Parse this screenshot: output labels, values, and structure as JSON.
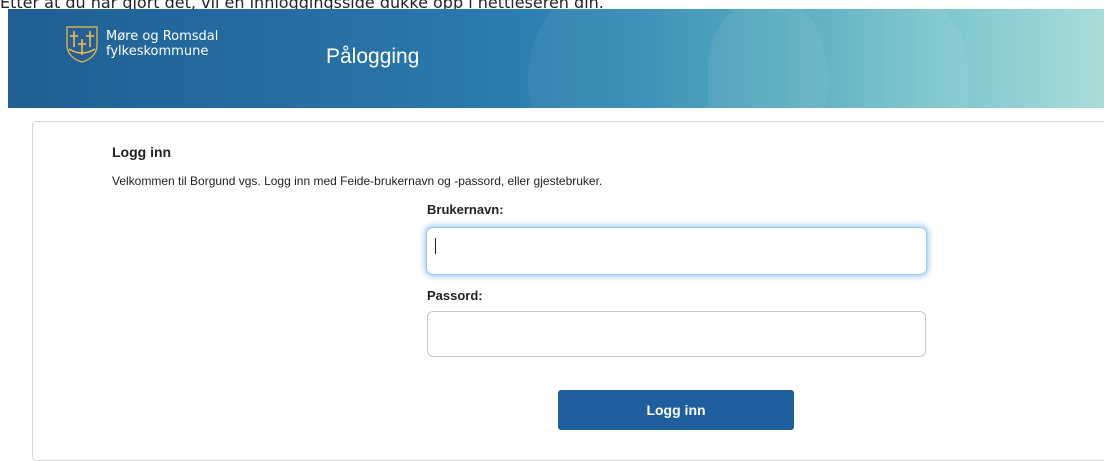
{
  "caption": "Etter at du har gjort det, vil en innloggingsside dukke opp i nettleseren din.",
  "header": {
    "org_line1": "Møre og Romsdal",
    "org_line2": "fylkeskommune",
    "title": "Pålogging",
    "logo_icon": "county-coat-of-arms-icon"
  },
  "login": {
    "title": "Logg inn",
    "description": "Velkommen til Borgund vgs. Logg inn med Feide-brukernavn og -passord, eller gjestebruker.",
    "username_label": "Brukernavn:",
    "username_value": "",
    "password_label": "Passord:",
    "password_value": "",
    "submit_label": "Logg inn"
  },
  "colors": {
    "banner_start": "#1f5f93",
    "banner_end": "#a9dcd9",
    "button": "#1f5f9e",
    "focus_glow": "#a9d0f3"
  }
}
